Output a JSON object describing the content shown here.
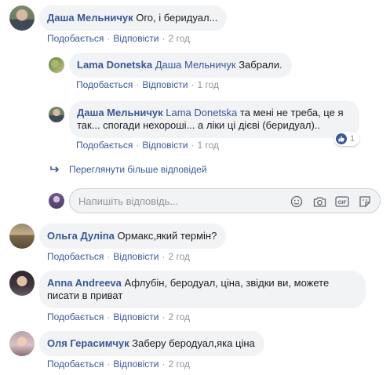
{
  "actions": {
    "like": "Подобається",
    "reply": "Відповісти",
    "separator": "·"
  },
  "comments": [
    {
      "author": "Даша Мельничук",
      "text": "Ого, і беридуал...",
      "time": "2 год",
      "avatar": "user-photo"
    },
    {
      "author": "Lama Donetska",
      "mention": "Даша Мельничук",
      "text": "Забрали.",
      "time": "1 год",
      "avatar": "user-photo"
    },
    {
      "author": "Даша Мельничук",
      "mention": "Lama Donetska",
      "text_line1": "та мені не треба, це я",
      "text_line2": "так... спогади нехороші... а ліки ці дієві (беридуал)..",
      "time": "1 год",
      "reaction_count": "1",
      "reaction_icon": "like-icon"
    },
    {
      "author": "Ольга Дуліпа",
      "text": "Ормакс,який термін?",
      "time": "2 год"
    },
    {
      "author": "Anna Andreeva",
      "text_line1": "Афлубін, беродуал, ціна, звідки ви, можете",
      "text_line2": "писати в приват",
      "time": "2 год"
    },
    {
      "author": "Оля Герасимчук",
      "text": "Заберу беродуал,яка ціна",
      "time": "2 год"
    }
  ],
  "more_replies": {
    "label": "Переглянути більше відповідей",
    "icon": "reply-arrow-icon"
  },
  "reply_box": {
    "placeholder": "Напишіть відповідь...",
    "icons": [
      "emoji-icon",
      "camera-icon",
      "gif-icon",
      "sticker-icon"
    ]
  },
  "colors": {
    "link": "#385898",
    "meta": "#90949c",
    "bubble": "#f2f3f5"
  }
}
